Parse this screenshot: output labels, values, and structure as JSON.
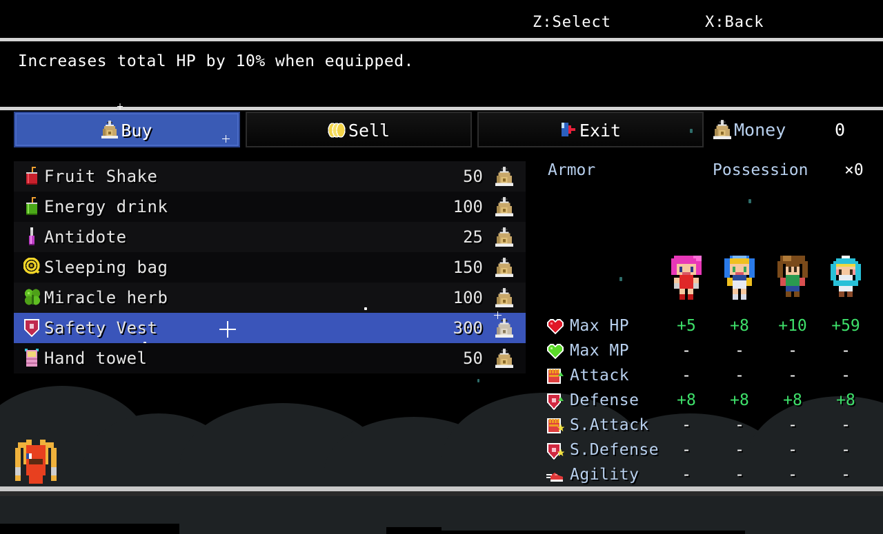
{
  "hud": {
    "select_hint": "Z:Select",
    "back_hint": "X:Back"
  },
  "description": {
    "text": "Increases total HP by 10% when equipped."
  },
  "tabs": [
    {
      "id": "buy",
      "label": "Buy",
      "icon": "money-bag-icon",
      "active": true
    },
    {
      "id": "sell",
      "label": "Sell",
      "icon": "coins-icon",
      "active": false
    },
    {
      "id": "exit",
      "label": "Exit",
      "icon": "exit-door-icon",
      "active": false
    }
  ],
  "money": {
    "label": "Money",
    "icon": "money-bag-icon",
    "value": "0"
  },
  "shop": {
    "currency_icon": "money-bag-icon",
    "items": [
      {
        "name": "Fruit Shake",
        "price": "50",
        "icon": "red-drink-icon",
        "selected": false
      },
      {
        "name": "Energy drink",
        "price": "100",
        "icon": "green-drink-icon",
        "selected": false
      },
      {
        "name": "Antidote",
        "price": "25",
        "icon": "antidote-vial-icon",
        "selected": false
      },
      {
        "name": "Sleeping bag",
        "price": "150",
        "icon": "sleeping-bag-icon",
        "selected": false
      },
      {
        "name": "Miracle herb",
        "price": "100",
        "icon": "clover-herb-icon",
        "selected": false
      },
      {
        "name": "Safety Vest",
        "price": "300",
        "icon": "shield-vest-icon",
        "selected": true
      },
      {
        "name": "Hand towel",
        "price": "50",
        "icon": "towel-icon",
        "selected": false
      }
    ]
  },
  "stats_panel": {
    "item_kind": "Armor",
    "possession_label": "Possession",
    "possession_count": "×0",
    "party": [
      {
        "id": "char-pink",
        "name": "party-member-1"
      },
      {
        "id": "char-blue",
        "name": "party-member-2"
      },
      {
        "id": "char-brown",
        "name": "party-member-3"
      },
      {
        "id": "char-cyan",
        "name": "party-member-4"
      }
    ],
    "rows": [
      {
        "stat": "Max HP",
        "icon": "red-heart-icon",
        "values": [
          "+5",
          "+8",
          "+10",
          "+59"
        ]
      },
      {
        "stat": "Max MP",
        "icon": "green-heart-icon",
        "values": [
          "-",
          "-",
          "-",
          "-"
        ]
      },
      {
        "stat": "Attack",
        "icon": "fist-up-icon",
        "values": [
          "-",
          "-",
          "-",
          "-"
        ]
      },
      {
        "stat": "Defense",
        "icon": "shield-up-icon",
        "values": [
          "+8",
          "+8",
          "+8",
          "+8"
        ]
      },
      {
        "stat": "S.Attack",
        "icon": "fist-star-icon",
        "values": [
          "-",
          "-",
          "-",
          "-"
        ]
      },
      {
        "stat": "S.Defense",
        "icon": "shield-star-icon",
        "values": [
          "-",
          "-",
          "-",
          "-"
        ]
      },
      {
        "stat": "Agility",
        "icon": "running-shoe-icon",
        "values": [
          "-",
          "-",
          "-",
          "-"
        ]
      }
    ]
  },
  "colors": {
    "selection_blue": "#3a55ba",
    "tab_active_blue": "#3a5bb5",
    "stat_label_blue": "#b8d0ee",
    "stat_plus_green": "#3ee06a",
    "divider_gray": "#d4d4d4",
    "row_dark": "#111113",
    "background": "#000000"
  },
  "overworld": {
    "npc": "shopkeeper-sprite"
  }
}
